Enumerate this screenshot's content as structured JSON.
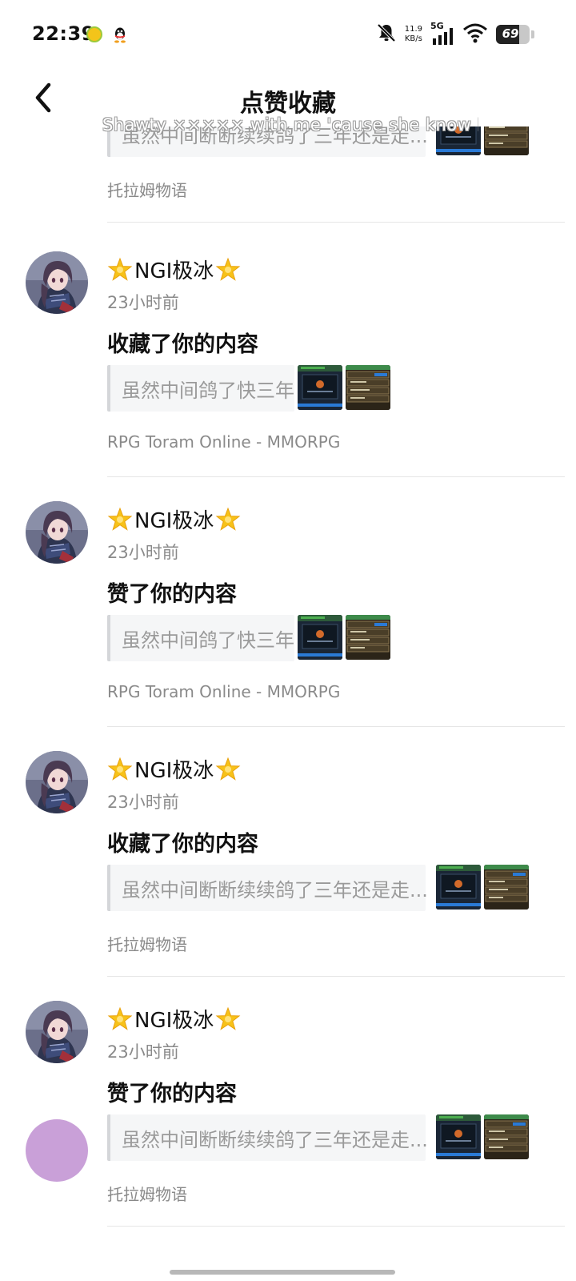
{
  "status_bar": {
    "time": "22:39",
    "net_speed_value": "11.9",
    "net_speed_unit": "KB/s",
    "network_type": "5G",
    "battery_level": "69",
    "battery_fraction": 0.69,
    "icons": [
      "music-app-icon",
      "qq-icon",
      "mute-bell-icon",
      "signal-icon",
      "wifi-icon",
      "battery-icon"
    ]
  },
  "header": {
    "title": "点赞收藏",
    "back_icon": "chevron-left-icon"
  },
  "lyric_overlay": "Shawty ××××× with me 'cause she know I'm",
  "partial_item": {
    "quote": "虽然中间断断续续鸽了三年还是走...",
    "game": "托拉姆物语"
  },
  "notifications": [
    {
      "user": "NGI极冰",
      "time": "23小时前",
      "action": "收藏了你的内容",
      "quote": "虽然中间鸽了快三年",
      "game": "RPG Toram Online - MMORPG"
    },
    {
      "user": "NGI极冰",
      "time": "23小时前",
      "action": "赞了你的内容",
      "quote": "虽然中间鸽了快三年",
      "game": "RPG Toram Online - MMORPG"
    },
    {
      "user": "NGI极冰",
      "time": "23小时前",
      "action": "收藏了你的内容",
      "quote": "虽然中间断断续续鸽了三年还是走...",
      "game": "托拉姆物语"
    },
    {
      "user": "NGI极冰",
      "time": "23小时前",
      "action": "赞了你的内容",
      "quote": "虽然中间断断续续鸽了三年还是走...",
      "game": "托拉姆物语"
    }
  ],
  "colors": {
    "title_text": "#111111",
    "secondary_text": "#8a8a8a",
    "quote_bg": "#f5f6f7",
    "divider": "#e6e6e6"
  }
}
